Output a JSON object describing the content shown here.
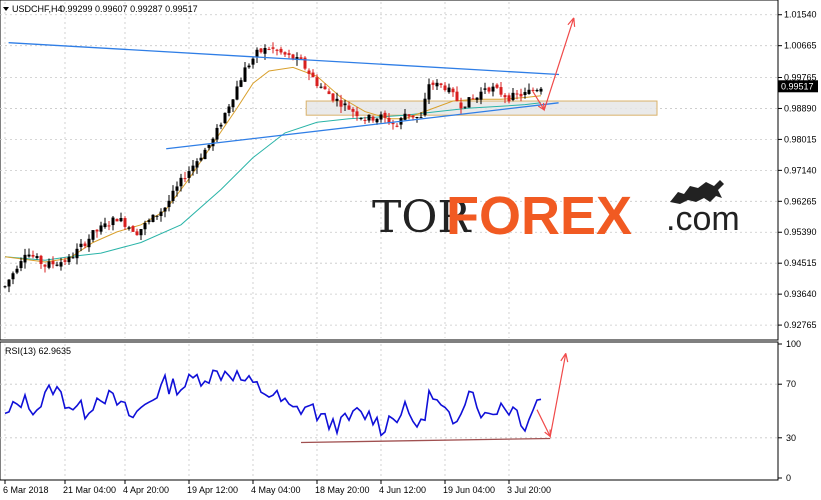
{
  "header": {
    "symbol": "USDCHF,H4",
    "ohlc": "0.99299 0.99607 0.99287 0.99517"
  },
  "logo": {
    "part1": "TOR",
    "part2": "FOREX",
    "part3": ".com"
  },
  "chart_data": [
    {
      "type": "candlestick",
      "title": "USDCHF,H4",
      "ylim": [
        0.924,
        1.019
      ],
      "y_ticks": [
        "1.01540",
        "1.00665",
        "0.99765",
        "0.98890",
        "0.98015",
        "0.97140",
        "0.96265",
        "0.95390",
        "0.94515",
        "0.93640",
        "0.92765"
      ],
      "y_tick_values": [
        1.0154,
        1.00665,
        0.99765,
        0.9889,
        0.98015,
        0.9714,
        0.96265,
        0.9539,
        0.94515,
        0.9364,
        0.92765
      ],
      "current_price": "0.99517",
      "x_labels": [
        "6 Mar 2018",
        "21 Mar 04:00",
        "4 Apr 20:00",
        "19 Apr 12:00",
        "4 May 04:00",
        "18 May 20:00",
        "4 Jun 12:00",
        "19 Jun 04:00",
        "3 Jul 20:00"
      ],
      "x_label_index": [
        0,
        15,
        30,
        46,
        62,
        78,
        94,
        110,
        126
      ],
      "num_bars": 135,
      "close_path": [
        [
          0,
          0.9385
        ],
        [
          5,
          0.9485
        ],
        [
          10,
          0.9445
        ],
        [
          16,
          0.9462
        ],
        [
          22,
          0.9535
        ],
        [
          28,
          0.958
        ],
        [
          33,
          0.954
        ],
        [
          40,
          0.961
        ],
        [
          45,
          0.97
        ],
        [
          52,
          0.98
        ],
        [
          56,
          0.99
        ],
        [
          60,
          1.0
        ],
        [
          63,
          1.0045
        ],
        [
          66,
          1.006
        ],
        [
          70,
          1.004
        ],
        [
          74,
          1.002
        ],
        [
          78,
          0.996
        ],
        [
          82,
          0.992
        ],
        [
          86,
          0.989
        ],
        [
          90,
          0.986
        ],
        [
          94,
          0.9865
        ],
        [
          98,
          0.984
        ],
        [
          100,
          0.9875
        ],
        [
          104,
          0.986
        ],
        [
          106,
          0.996
        ],
        [
          110,
          0.995
        ],
        [
          114,
          0.99
        ],
        [
          118,
          0.992
        ],
        [
          120,
          0.995
        ],
        [
          122,
          0.9945
        ],
        [
          126,
          0.992
        ],
        [
          130,
          0.993
        ],
        [
          134,
          0.9952
        ]
      ],
      "ma_fast": [
        [
          0,
          0.947
        ],
        [
          10,
          0.9455
        ],
        [
          16,
          0.9465
        ],
        [
          22,
          0.951
        ],
        [
          28,
          0.954
        ],
        [
          34,
          0.956
        ],
        [
          40,
          0.96
        ],
        [
          46,
          0.969
        ],
        [
          52,
          0.979
        ],
        [
          58,
          0.989
        ],
        [
          62,
          0.996
        ],
        [
          66,
          0.9995
        ],
        [
          72,
          1.0005
        ],
        [
          78,
          0.998
        ],
        [
          84,
          0.992
        ],
        [
          90,
          0.988
        ],
        [
          96,
          0.986
        ],
        [
          100,
          0.986
        ],
        [
          106,
          0.9885
        ],
        [
          112,
          0.991
        ],
        [
          118,
          0.9915
        ],
        [
          124,
          0.9915
        ],
        [
          130,
          0.992
        ],
        [
          134,
          0.9925
        ]
      ],
      "ma_slow": [
        [
          0,
          0.947
        ],
        [
          10,
          0.946
        ],
        [
          16,
          0.947
        ],
        [
          24,
          0.948
        ],
        [
          34,
          0.951
        ],
        [
          44,
          0.956
        ],
        [
          54,
          0.966
        ],
        [
          62,
          0.975
        ],
        [
          70,
          0.982
        ],
        [
          78,
          0.985
        ],
        [
          86,
          0.986
        ],
        [
          94,
          0.9865
        ],
        [
          100,
          0.987
        ],
        [
          108,
          0.988
        ],
        [
          116,
          0.989
        ],
        [
          124,
          0.9895
        ],
        [
          130,
          0.99
        ],
        [
          134,
          0.9905
        ]
      ],
      "zone": [
        0.987,
        0.991
      ],
      "trendline_upper": [
        [
          0.9,
          1.0075
        ],
        [
          138.5,
          0.9985
        ]
      ],
      "trendline_lower": [
        [
          40.3,
          0.9775
        ],
        [
          138.4,
          0.9905
        ]
      ],
      "forecast_arrow": [
        [
          131.9,
          0.9938
        ],
        [
          134.8,
          0.9885
        ],
        [
          142.2,
          1.0145
        ]
      ]
    },
    {
      "type": "line",
      "title": "RSI(13) 62.9635",
      "ylim": [
        0,
        100
      ],
      "y_ticks": [
        "100",
        "70",
        "30",
        "0"
      ],
      "y_tick_values": [
        100,
        70,
        30,
        0
      ],
      "levels": [
        70,
        30
      ],
      "rsi_path": [
        [
          0,
          45
        ],
        [
          4,
          58
        ],
        [
          8,
          52
        ],
        [
          12,
          68
        ],
        [
          16,
          55
        ],
        [
          20,
          50
        ],
        [
          24,
          63
        ],
        [
          28,
          56
        ],
        [
          32,
          45
        ],
        [
          36,
          58
        ],
        [
          40,
          70
        ],
        [
          44,
          68
        ],
        [
          48,
          75
        ],
        [
          52,
          77
        ],
        [
          56,
          80
        ],
        [
          60,
          72
        ],
        [
          64,
          66
        ],
        [
          68,
          60
        ],
        [
          72,
          50
        ],
        [
          76,
          54
        ],
        [
          80,
          42
        ],
        [
          84,
          40
        ],
        [
          88,
          48
        ],
        [
          92,
          46
        ],
        [
          94,
          37
        ],
        [
          96,
          44
        ],
        [
          100,
          50
        ],
        [
          104,
          38
        ],
        [
          106,
          62
        ],
        [
          110,
          48
        ],
        [
          112,
          38
        ],
        [
          116,
          69
        ],
        [
          120,
          45
        ],
        [
          124,
          55
        ],
        [
          128,
          50
        ],
        [
          130,
          40
        ],
        [
          134,
          63
        ]
      ],
      "support_line": [
        [
          0,
          29.5
        ],
        [
          136.3,
          29.5
        ]
      ],
      "forecast_arrow": [
        [
          133,
          51
        ],
        [
          136.3,
          31
        ],
        [
          140.2,
          93
        ]
      ]
    }
  ],
  "colors": {
    "bull_candle": "#000000",
    "bear_candle": "#d81f1f",
    "ma_fast": "#d9a02c",
    "ma_slow": "#2ab4a8",
    "trendline": "#2f7ee6",
    "zone": "#e6e6e6",
    "rsi": "#1010d8",
    "support": "#a05050",
    "forecast_arrow": "#f04a4a",
    "grid": "#c8c8c8"
  }
}
